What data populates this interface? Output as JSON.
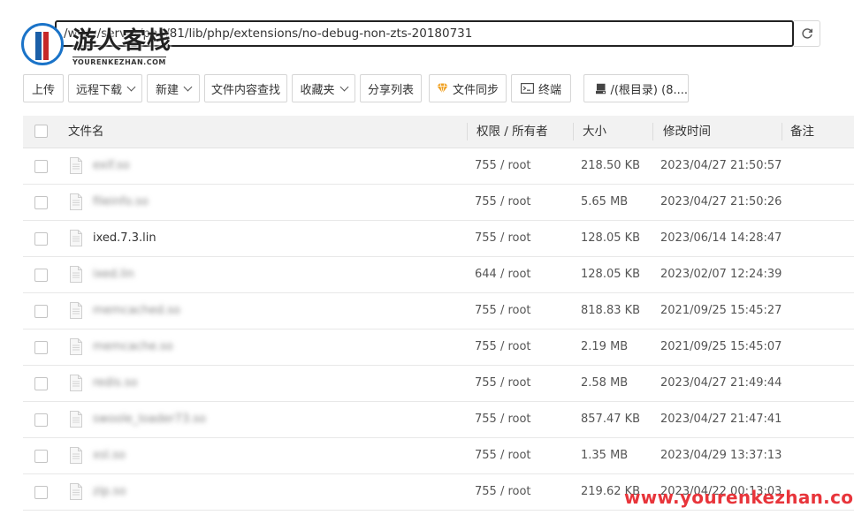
{
  "logo": {
    "title": "游人客栈",
    "subtitle": "YOURENKEZHAN.COM"
  },
  "address": {
    "path": "/www/server/php/81/lib/php/extensions/no-debug-non-zts-20180731"
  },
  "toolbar": {
    "upload": "上传",
    "remote_download": "远程下载",
    "new": "新建",
    "content_search": "文件内容查找",
    "favorites": "收藏夹",
    "share_list": "分享列表",
    "file_sync": "文件同步",
    "terminal": "终端",
    "root_dir": "/(根目录) (8...."
  },
  "columns": {
    "name": "文件名",
    "perm": "权限 / 所有者",
    "size": "大小",
    "mtime": "修改时间",
    "note": "备注"
  },
  "rows": [
    {
      "name": "exif.so",
      "perm": "755 / root",
      "size": "218.50 KB",
      "mtime": "2023/04/27 21:50:57",
      "blurred": true
    },
    {
      "name": "fileinfo.so",
      "perm": "755 / root",
      "size": "5.65 MB",
      "mtime": "2023/04/27 21:50:26",
      "blurred": true
    },
    {
      "name": "ixed.7.3.lin",
      "perm": "755 / root",
      "size": "128.05 KB",
      "mtime": "2023/06/14 14:28:47",
      "blurred": false
    },
    {
      "name": "ixed.lin",
      "perm": "644 / root",
      "size": "128.05 KB",
      "mtime": "2023/02/07 12:24:39",
      "blurred": true
    },
    {
      "name": "memcached.so",
      "perm": "755 / root",
      "size": "818.83 KB",
      "mtime": "2021/09/25 15:45:27",
      "blurred": true
    },
    {
      "name": "memcache.so",
      "perm": "755 / root",
      "size": "2.19 MB",
      "mtime": "2021/09/25 15:45:07",
      "blurred": true
    },
    {
      "name": "redis.so",
      "perm": "755 / root",
      "size": "2.58 MB",
      "mtime": "2023/04/27 21:49:44",
      "blurred": true
    },
    {
      "name": "swoole_loader73.so",
      "perm": "755 / root",
      "size": "857.47 KB",
      "mtime": "2023/04/27 21:47:41",
      "blurred": true
    },
    {
      "name": "xsl.so",
      "perm": "755 / root",
      "size": "1.35 MB",
      "mtime": "2023/04/29 13:37:13",
      "blurred": true
    },
    {
      "name": "zip.so",
      "perm": "755 / root",
      "size": "219.62 KB",
      "mtime": "2023/04/22 00:13:03",
      "blurred": true
    }
  ],
  "watermark": "www.yourenkezhan.com",
  "icons": {
    "refresh": "refresh-icon",
    "file_sync": "diamond-icon",
    "terminal": "terminal-icon",
    "root_dir": "disk-icon",
    "file": "file-icon"
  },
  "colors": {
    "header_bg": "#f2f2f2",
    "border": "#d6d6d6",
    "watermark": "#e8353b",
    "sync_icon": "#f0a020"
  }
}
